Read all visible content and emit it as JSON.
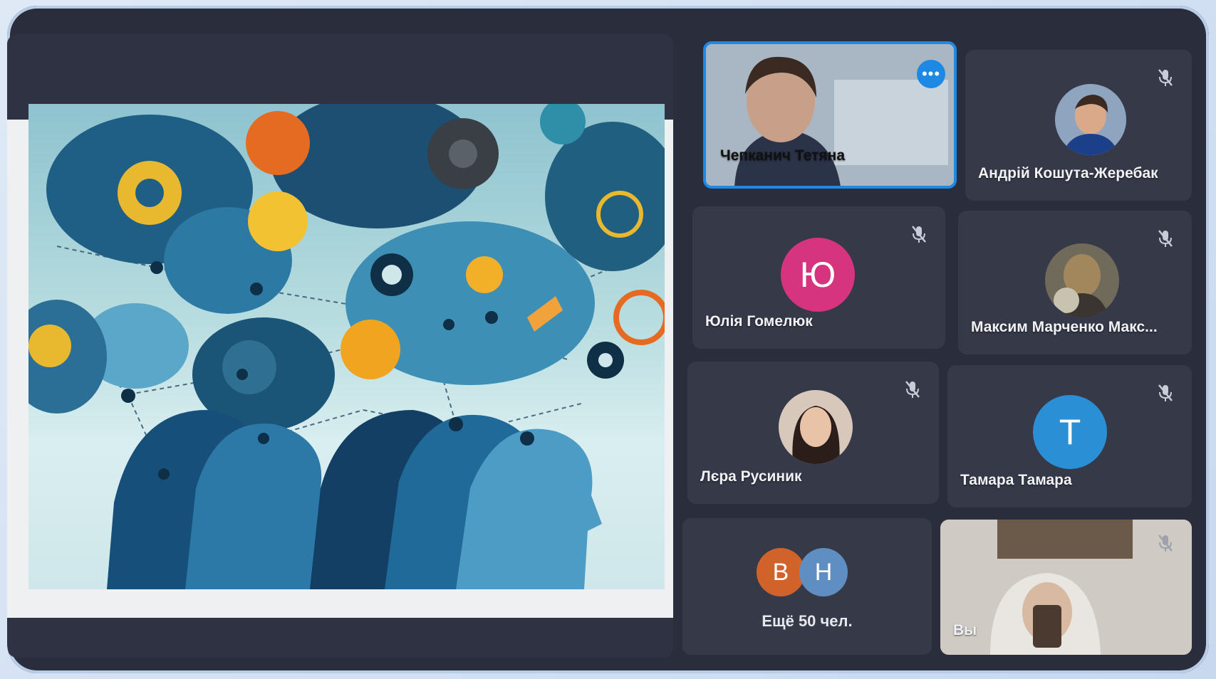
{
  "participants": {
    "speaker": {
      "name": "Чепканич Тетяна"
    },
    "p1": {
      "name": "Андрій Кошута-Жеребак"
    },
    "p2": {
      "name": "Юлія Гомелюк",
      "initial": "Ю",
      "color": "#d6347f"
    },
    "p3": {
      "name": "Максим Марченко Макс..."
    },
    "p4": {
      "name": "Лєра Русиник"
    },
    "p5": {
      "name": "Тамара Тамара",
      "initial": "Т",
      "color": "#2a8fd4"
    },
    "more": {
      "label": "Ещё 50 чел.",
      "initials": [
        "В",
        "Н"
      ],
      "colors": [
        "#d1622a",
        "#5f8fc2"
      ]
    },
    "self": {
      "name": "Вы"
    }
  },
  "icons": {
    "mute": "mic-off-icon",
    "options": "more-options-icon"
  },
  "colors": {
    "accent": "#1e88e5",
    "tile_bg": "#363948",
    "frame_bg": "#2a2d3c"
  }
}
